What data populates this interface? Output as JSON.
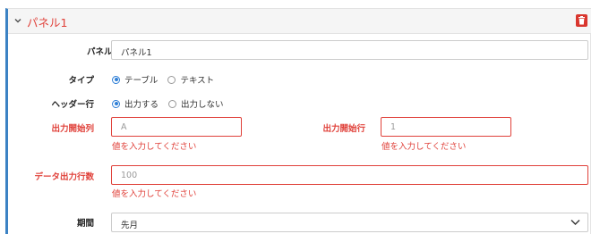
{
  "panel": {
    "title": "パネル1",
    "accent_color": "#3b82c4",
    "error_color": "#e0413a",
    "icons": {
      "toggle": "chevron-down-icon",
      "delete": "trash-icon"
    }
  },
  "form": {
    "panel_name": {
      "label": "パネル名",
      "value": "パネル1"
    },
    "type": {
      "label": "タイプ",
      "options": [
        {
          "label": "テーブル",
          "selected": true
        },
        {
          "label": "テキスト",
          "selected": false
        }
      ]
    },
    "header_row": {
      "label": "ヘッダー行",
      "options": [
        {
          "label": "出力する",
          "selected": true
        },
        {
          "label": "出力しない",
          "selected": false
        }
      ]
    },
    "start_col": {
      "label": "出力開始列",
      "placeholder": "A",
      "error": "値を入力してください"
    },
    "start_row": {
      "label": "出力開始行",
      "placeholder": "1",
      "error": "値を入力してください"
    },
    "data_rows": {
      "label": "データ出力行数",
      "placeholder": "100",
      "error": "値を入力してください"
    },
    "period": {
      "label": "期間",
      "value": "先月"
    }
  }
}
